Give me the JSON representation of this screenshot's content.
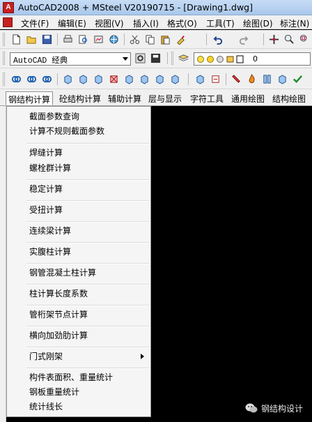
{
  "window": {
    "title": "AutoCAD2008 + MSteel V20190715 - [Drawing1.dwg]"
  },
  "menubar": {
    "items": [
      "文件(F)",
      "编辑(E)",
      "视图(V)",
      "插入(I)",
      "格式(O)",
      "工具(T)",
      "绘图(D)",
      "标注(N)"
    ]
  },
  "workspace": {
    "selected": "AutoCAD 经典"
  },
  "layer": {
    "selected": "0"
  },
  "tabs": [
    "钢结构计算",
    "砼结构计算",
    "辅助计算",
    "层与显示",
    "字符工具",
    "通用绘图",
    "结构绘图"
  ],
  "dropdown": {
    "items": [
      "截面参数查询",
      "计算不规则截面参数",
      "焊缝计算",
      "螺栓群计算",
      "稳定计算",
      "受扭计算",
      "连续梁计算",
      "实腹柱计算",
      "钢管混凝土柱计算",
      "柱计算长度系数",
      "管桁架节点计算",
      "横向加劲肋计算",
      "门式刚架",
      "构件表面积、重量统计",
      "钢板重量统计",
      "统计线长"
    ]
  },
  "watermark": {
    "text": "钢结构设计"
  },
  "colors": {
    "canvas": "#000000",
    "titlebar": "#b9d1ee",
    "app_icon": "#c62020"
  }
}
